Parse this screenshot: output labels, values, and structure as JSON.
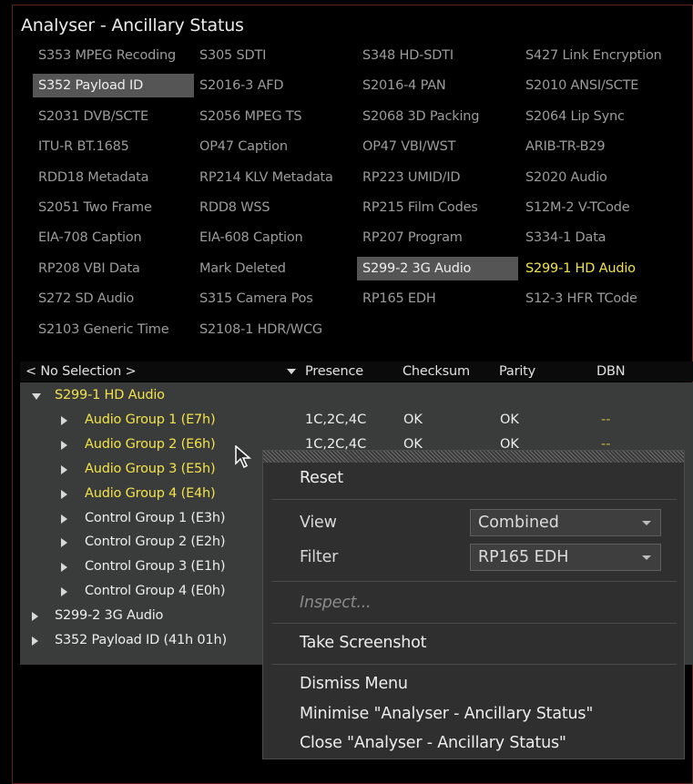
{
  "window": {
    "title": "Analyser - Ancillary Status"
  },
  "grid": {
    "items": [
      {
        "label": "S353 MPEG Recoding",
        "state": "normal"
      },
      {
        "label": "S305 SDTI",
        "state": "normal"
      },
      {
        "label": "S348 HD-SDTI",
        "state": "normal"
      },
      {
        "label": "S427 Link Encryption",
        "state": "normal"
      },
      {
        "label": "S352 Payload ID",
        "state": "selected"
      },
      {
        "label": "S2016-3 AFD",
        "state": "normal"
      },
      {
        "label": "S2016-4 PAN",
        "state": "normal"
      },
      {
        "label": "S2010 ANSI/SCTE",
        "state": "normal"
      },
      {
        "label": "S2031 DVB/SCTE",
        "state": "normal"
      },
      {
        "label": "S2056 MPEG TS",
        "state": "normal"
      },
      {
        "label": "S2068 3D Packing",
        "state": "normal"
      },
      {
        "label": "S2064 Lip Sync",
        "state": "normal"
      },
      {
        "label": "ITU-R BT.1685",
        "state": "normal"
      },
      {
        "label": "OP47 Caption",
        "state": "normal"
      },
      {
        "label": "OP47 VBI/WST",
        "state": "normal"
      },
      {
        "label": "ARIB-TR-B29",
        "state": "normal"
      },
      {
        "label": "RDD18 Metadata",
        "state": "normal"
      },
      {
        "label": "RP214 KLV Metadata",
        "state": "normal"
      },
      {
        "label": "RP223 UMID/ID",
        "state": "normal"
      },
      {
        "label": "S2020 Audio",
        "state": "normal"
      },
      {
        "label": "S2051 Two Frame",
        "state": "normal"
      },
      {
        "label": "RDD8 WSS",
        "state": "normal"
      },
      {
        "label": "RP215 Film Codes",
        "state": "normal"
      },
      {
        "label": "S12M-2 V-TCode",
        "state": "normal"
      },
      {
        "label": "EIA-708 Caption",
        "state": "normal"
      },
      {
        "label": "EIA-608 Caption",
        "state": "normal"
      },
      {
        "label": "RP207 Program",
        "state": "normal"
      },
      {
        "label": "S334-1 Data",
        "state": "normal"
      },
      {
        "label": "RP208 VBI Data",
        "state": "normal"
      },
      {
        "label": "Mark Deleted",
        "state": "normal"
      },
      {
        "label": "S299-2 3G Audio",
        "state": "selected"
      },
      {
        "label": "S299-1 HD Audio",
        "state": "highlight"
      },
      {
        "label": "S272 SD Audio",
        "state": "normal"
      },
      {
        "label": "S315 Camera Pos",
        "state": "normal"
      },
      {
        "label": "RP165 EDH",
        "state": "normal"
      },
      {
        "label": "S12-3 HFR TCode",
        "state": "normal"
      },
      {
        "label": "S2103 Generic Time",
        "state": "normal"
      },
      {
        "label": "S2108-1 HDR/WCG",
        "state": "normal"
      }
    ]
  },
  "table": {
    "selector": "< No Selection >",
    "columns": [
      "Presence",
      "Checksum",
      "Parity",
      "DBN"
    ],
    "rows": [
      {
        "label": "S299-1 HD Audio",
        "level": 0,
        "expanded": true,
        "color": "yellow"
      },
      {
        "label": "Audio Group 1 (E7h)",
        "level": 1,
        "expanded": false,
        "color": "yellow",
        "presence": "1C,2C,4C",
        "checksum": "OK",
        "parity": "OK",
        "dbn": "--"
      },
      {
        "label": "Audio Group 2 (E6h)",
        "level": 1,
        "expanded": false,
        "color": "yellow",
        "presence": "1C,2C,4C",
        "checksum": "OK",
        "parity": "OK",
        "dbn": "--"
      },
      {
        "label": "Audio Group 3 (E5h)",
        "level": 1,
        "expanded": false,
        "color": "yellow"
      },
      {
        "label": "Audio Group 4 (E4h)",
        "level": 1,
        "expanded": false,
        "color": "yellow"
      },
      {
        "label": "Control Group 1 (E3h)",
        "level": 1,
        "expanded": false,
        "color": "white"
      },
      {
        "label": "Control Group 2 (E2h)",
        "level": 1,
        "expanded": false,
        "color": "white"
      },
      {
        "label": "Control Group 3 (E1h)",
        "level": 1,
        "expanded": false,
        "color": "white"
      },
      {
        "label": "Control Group 4 (E0h)",
        "level": 1,
        "expanded": false,
        "color": "white"
      },
      {
        "label": "S299-2 3G Audio",
        "level": 0,
        "expanded": false,
        "color": "white"
      },
      {
        "label": "S352 Payload ID (41h 01h)",
        "level": 0,
        "expanded": false,
        "color": "white"
      }
    ]
  },
  "context_menu": {
    "reset": "Reset",
    "view_label": "View",
    "view_value": "Combined",
    "filter_label": "Filter",
    "filter_value": "RP165 EDH",
    "inspect": "Inspect...",
    "screenshot": "Take Screenshot",
    "dismiss": "Dismiss Menu",
    "minimise": "Minimise \"Analyser - Ancillary Status\"",
    "close": "Close \"Analyser - Ancillary Status\""
  },
  "colors": {
    "highlight": "#f2e24a",
    "selected_bg": "#555555",
    "menu_bg": "#2f2f2f"
  }
}
